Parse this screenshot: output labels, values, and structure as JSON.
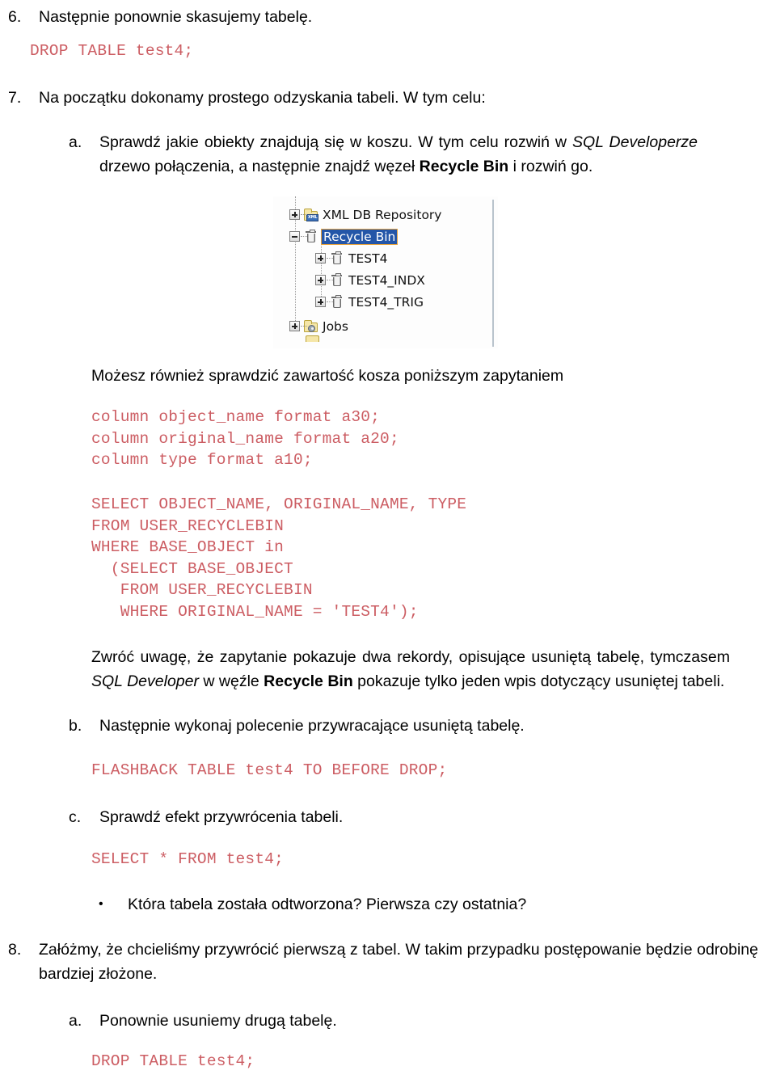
{
  "document": {
    "language": "pl",
    "items": [
      {
        "id": "item-6",
        "marker": "6.",
        "text": "Następnie ponownie skasujemy tabelę."
      },
      {
        "id": "code-drop-1",
        "code": "DROP TABLE test4;"
      },
      {
        "id": "item-7",
        "marker": "7.",
        "text": "Na początku dokonamy prostego odzyskania tabeli. W tym celu:"
      },
      {
        "id": "item-7a",
        "marker": "a.",
        "text_part_1": "Sprawdź jakie obiekty znajdują się w koszu. W tym celu rozwiń w ",
        "text_italic_1": "SQL Developerze",
        "text_part_2": " drzewo połączenia, a następnie znajdź węzeł ",
        "text_bold_1": "Recycle Bin",
        "text_part_3": " i rozwiń go."
      },
      {
        "id": "para-query-intro",
        "text": "Możesz również sprawdzić zawartość kosza poniższym zapytaniem"
      },
      {
        "id": "code-column-formats",
        "code": "column object_name format a30;\ncolumn original_name format a20;\ncolumn type format a10;"
      },
      {
        "id": "code-select-recyclebin",
        "code": "SELECT OBJECT_NAME, ORIGINAL_NAME, TYPE\nFROM USER_RECYCLEBIN\nWHERE BASE_OBJECT in\n  (SELECT BASE_OBJECT\n   FROM USER_RECYCLEBIN\n   WHERE ORIGINAL_NAME = 'TEST4');"
      },
      {
        "id": "para-note",
        "text_part_1": "Zwróć uwagę, że zapytanie pokazuje dwa rekordy, opisujące usuniętą tabelę, tymczasem ",
        "text_italic_1": "SQL Developer",
        "text_part_2": " w węźle ",
        "text_bold_1": "Recycle Bin",
        "text_part_3": " pokazuje tylko jeden wpis dotyczący usuniętej tabeli."
      },
      {
        "id": "item-7b",
        "marker": "b.",
        "text": "Następnie wykonaj polecenie przywracające usuniętą tabelę."
      },
      {
        "id": "code-flashback",
        "code": "FLASHBACK TABLE test4 TO BEFORE DROP;"
      },
      {
        "id": "item-7c",
        "marker": "c.",
        "text": "Sprawdź efekt przywrócenia tabeli."
      },
      {
        "id": "code-select-test4",
        "code": "SELECT * FROM test4;"
      },
      {
        "id": "bullet-question",
        "marker": "•",
        "text": "Która tabela została odtworzona? Pierwsza czy ostatnia?"
      },
      {
        "id": "item-8",
        "marker": "8.",
        "text": "Załóżmy, że chcieliśmy przywrócić pierwszą z tabel. W takim przypadku postępowanie będzie odrobinę bardziej złożone."
      },
      {
        "id": "item-8a",
        "marker": "a.",
        "text": "Ponownie usuniemy drugą tabelę."
      },
      {
        "id": "code-drop-2",
        "code": "DROP TABLE test4;"
      }
    ]
  },
  "figure": {
    "name": "sql-developer-recycle-bin-tree",
    "tree_nodes": [
      {
        "label": "XML DB Repository",
        "toggle": "plus",
        "icon": "xml-folder-icon",
        "selected": false,
        "depth": 0
      },
      {
        "label": "Recycle Bin",
        "toggle": "minus",
        "icon": "recycle-bin-icon",
        "selected": true,
        "depth": 0
      },
      {
        "label": "TEST4",
        "toggle": "plus",
        "icon": "recycle-bin-icon",
        "selected": false,
        "depth": 1
      },
      {
        "label": "TEST4_INDX",
        "toggle": "plus",
        "icon": "recycle-bin-icon",
        "selected": false,
        "depth": 1
      },
      {
        "label": "TEST4_TRIG",
        "toggle": "plus",
        "icon": "recycle-bin-icon",
        "selected": false,
        "depth": 1
      },
      {
        "label": "Jobs",
        "toggle": "plus",
        "icon": "jobs-folder-icon",
        "selected": false,
        "depth": 0
      }
    ]
  },
  "colors": {
    "code_red": "#cc5d63",
    "body_black": "#000000",
    "tree_selection_blue": "#2456a8",
    "tree_selection_border": "#e8a33d",
    "folder_yellow": "#f5e6a8"
  }
}
